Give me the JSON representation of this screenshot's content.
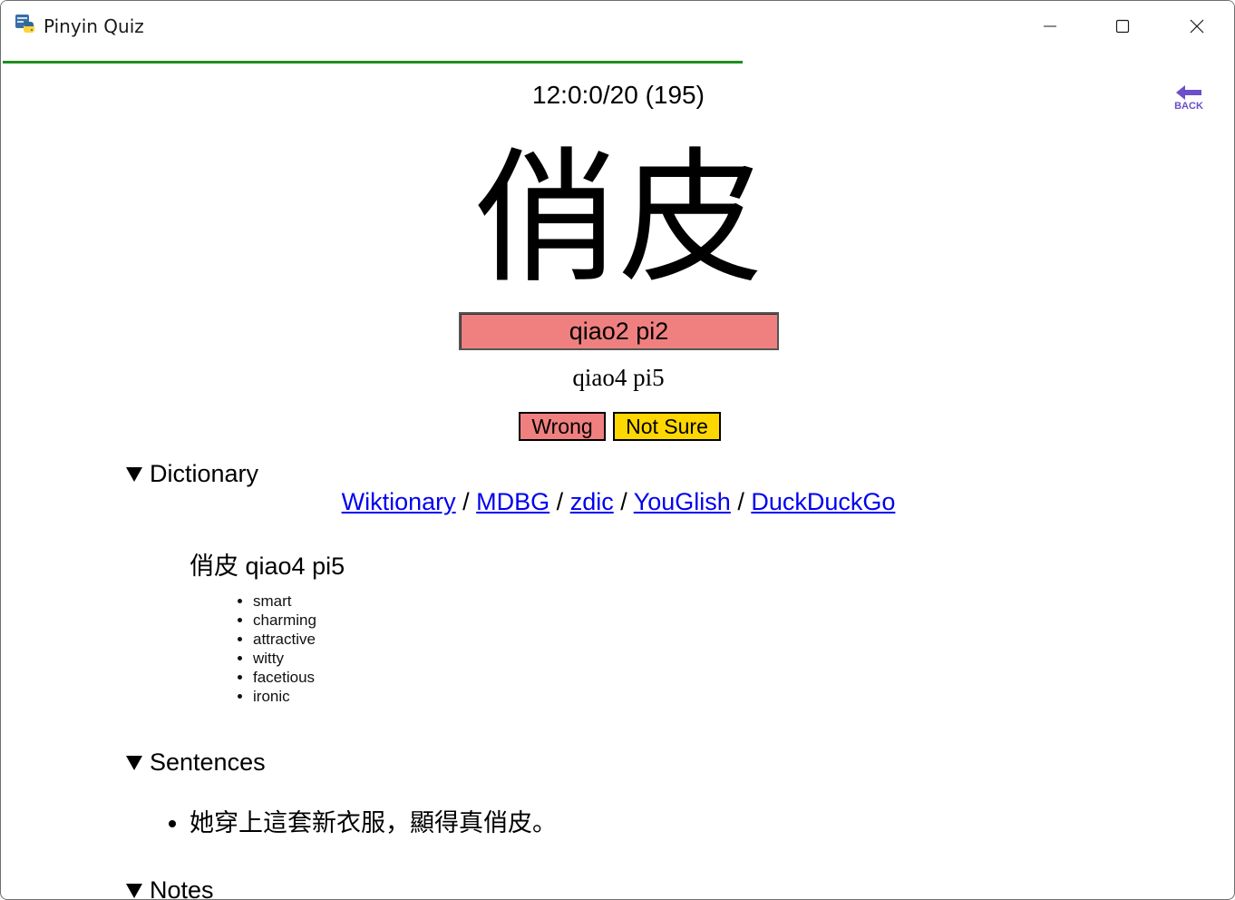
{
  "window": {
    "title": "Pinyin Quiz"
  },
  "quiz": {
    "progress_fraction": 0.6,
    "counter": "12:0:0/20 (195)",
    "back_label": "BACK",
    "hanzi": "俏皮",
    "answer_value": "qiao2 pi2",
    "correct_pinyin": "qiao4 pi5",
    "buttons": {
      "wrong": "Wrong",
      "not_sure": "Not Sure"
    },
    "colors": {
      "wrong_bg": "#f08080",
      "notsure_bg": "#ffd700",
      "progress": "#1e8f1e",
      "back": "#6b4fc8"
    }
  },
  "dictionary": {
    "summary": "Dictionary",
    "links": [
      "Wiktionary",
      "MDBG",
      "zdic",
      "YouGlish",
      "DuckDuckGo"
    ],
    "separator": " / ",
    "entry": "俏皮 qiao4 pi5",
    "meanings": [
      "smart",
      "charming",
      "attractive",
      "witty",
      "facetious",
      "ironic"
    ]
  },
  "sentences": {
    "summary": "Sentences",
    "items": [
      "她穿上這套新衣服，顯得真俏皮。"
    ]
  },
  "notes": {
    "summary": "Notes"
  },
  "icons": {
    "app": "python-app-icon",
    "minimize": "minimize-icon",
    "maximize": "maximize-icon",
    "close": "close-icon",
    "back": "back-arrow-icon",
    "disclosure": "disclosure-triangle-icon"
  }
}
